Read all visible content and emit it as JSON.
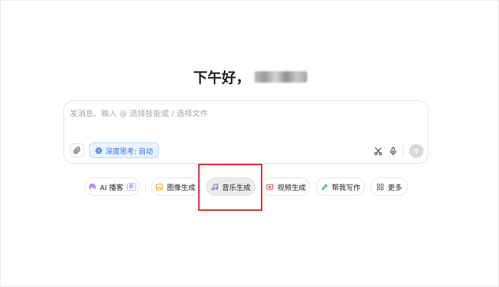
{
  "greeting": {
    "text": "下午好，"
  },
  "composer": {
    "placeholder": "发消息、输入 @ 选择技能或 / 选择文件",
    "deep_think_label": "深度思考: 自动"
  },
  "skills": [
    {
      "label": "AI 播客",
      "icon": "podcast-icon",
      "badge": "新"
    },
    {
      "label": "图像生成",
      "icon": "image-icon"
    },
    {
      "label": "音乐生成",
      "icon": "music-icon"
    },
    {
      "label": "视频生成",
      "icon": "video-icon"
    },
    {
      "label": "帮我写作",
      "icon": "pen-icon"
    },
    {
      "label": "更多",
      "icon": "grid-icon"
    }
  ],
  "colors": {
    "accent_blue": "#2e6fe0",
    "highlight_red": "#e0261e",
    "podcast_purple": "#9a4fd8",
    "image_orange": "#e6a400",
    "music_purple": "#7b5cd6",
    "video_red": "#e33b3b",
    "write_green": "#1fa35a",
    "more_gray": "#666666"
  }
}
